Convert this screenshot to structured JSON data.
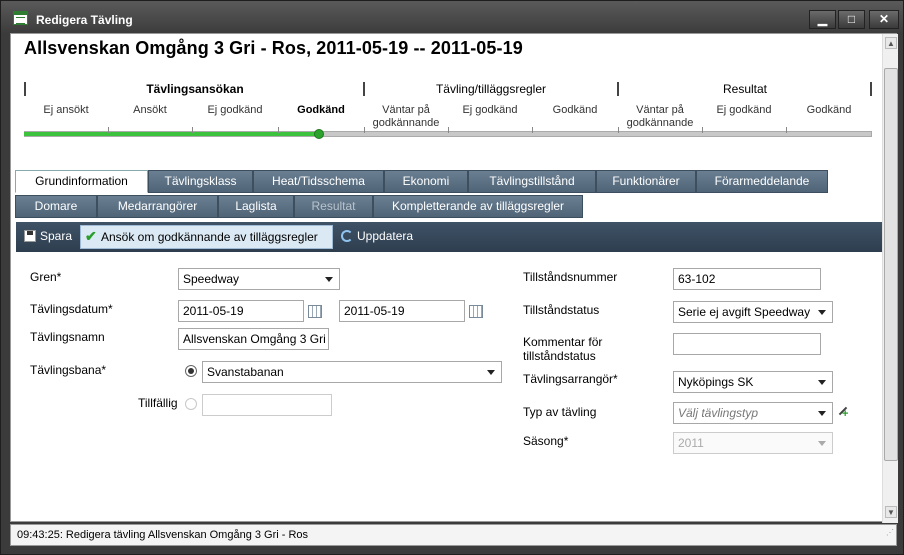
{
  "window": {
    "title": "Redigera Tävling",
    "minimize": "▁",
    "maximize": "□",
    "close": "✕",
    "icon": "form-icon"
  },
  "page_title": "Allsvenskan Omgång 3 Gri - Ros, 2011-05-19 -- 2011-05-19",
  "stages": [
    {
      "label": "Tävlingsansökan",
      "bold": true
    },
    {
      "label": "Tävling/tilläggsregler",
      "bold": false
    },
    {
      "label": "Resultat",
      "bold": false
    }
  ],
  "steps": [
    {
      "label": "Ej ansökt"
    },
    {
      "label": "Ansökt"
    },
    {
      "label": "Ej godkänd"
    },
    {
      "label": "Godkänd",
      "current": true
    },
    {
      "label": "Väntar på godkännande"
    },
    {
      "label": "Ej godkänd"
    },
    {
      "label": "Godkänd"
    },
    {
      "label": "Väntar på godkännande"
    },
    {
      "label": "Ej godkänd"
    },
    {
      "label": "Godkänd"
    }
  ],
  "progress": {
    "completed_steps": 4,
    "total_steps": 10
  },
  "tabs_row1": [
    {
      "label": "Grundinformation",
      "active": true
    },
    {
      "label": "Tävlingsklass"
    },
    {
      "label": "Heat/Tidsschema"
    },
    {
      "label": "Ekonomi"
    },
    {
      "label": "Tävlingstillstånd"
    },
    {
      "label": "Funktionärer"
    },
    {
      "label": "Förarmeddelande"
    }
  ],
  "tabs_row2": [
    {
      "label": "Domare"
    },
    {
      "label": "Medarrangörer"
    },
    {
      "label": "Laglista"
    },
    {
      "label": "Resultat",
      "disabled": true
    },
    {
      "label": "Kompletterande av tilläggsregler"
    }
  ],
  "toolbar": {
    "save": "Spara",
    "apply": "Ansök om godkännande av tilläggsregler",
    "refresh": "Uppdatera"
  },
  "form": {
    "gren_label": "Gren*",
    "gren_value": "Speedway",
    "datum_label": "Tävlingsdatum*",
    "datum_from": "2011-05-19",
    "datum_to": "2011-05-19",
    "namn_label": "Tävlingsnamn",
    "namn_value": "Allsvenskan Omgång 3 Gri -",
    "bana_label": "Tävlingsbana*",
    "bana_value": "Svanstabanan",
    "tillfallig_label": "Tillfällig",
    "tillfallig_value": "",
    "tillstandsnummer_label": "Tillståndsnummer",
    "tillstandsnummer_value": "63-102",
    "tillstandstatus_label": "Tillståndstatus",
    "tillstandstatus_value": "Serie ej avgift Speedway",
    "kommentar_label": "Kommentar för tillståndstatus",
    "kommentar_value": "",
    "arrangor_label": "Tävlingsarrangör*",
    "arrangor_value": "Nyköpings SK",
    "typ_label": "Typ av tävling",
    "typ_placeholder": "Välj tävlingstyp",
    "sasong_label": "Säsong*",
    "sasong_value": "2011"
  },
  "status": "09:43:25: Redigera tävling Allsvenskan Omgång 3 Gri - Ros"
}
